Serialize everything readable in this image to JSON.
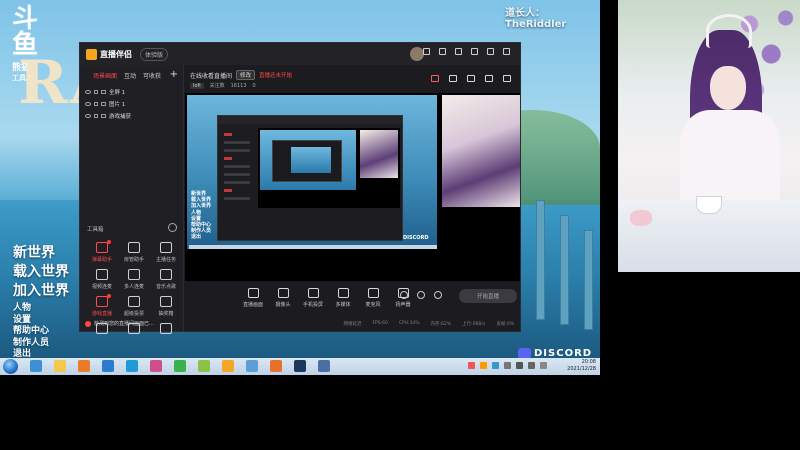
{
  "streamer": {
    "label": "道长人：TheRiddler"
  },
  "douyu": {
    "logo_big": "斗鱼",
    "logo_small": "熊猫",
    "logo_tag": "工具箱"
  },
  "game": {
    "logo": "RAF",
    "menu_big": [
      "新世界",
      "载入世界",
      "加入世界"
    ],
    "menu_small": [
      "人物",
      "设置",
      "帮助中心",
      "制作人员",
      "退出"
    ]
  },
  "discord": {
    "label": "DISCORD"
  },
  "app": {
    "name": "直播伴侣",
    "version_badge": "体验版",
    "side_tabs": [
      "场景画面",
      "互动",
      "可收获"
    ],
    "add_symbol": "+",
    "scenes": [
      "全屏 1",
      "图片 1",
      "游戏捕获"
    ],
    "toolbox": {
      "title": "工具箱",
      "tools": [
        {
          "label": "弹幕助手",
          "icon": "danmaku-icon",
          "active": true
        },
        {
          "label": "房管助手",
          "icon": "admin-icon",
          "active": false
        },
        {
          "label": "主播任务",
          "icon": "task-icon",
          "active": false
        },
        {
          "label": "视频连麦",
          "icon": "video-link-icon",
          "active": false
        },
        {
          "label": "多人连麦",
          "icon": "multi-link-icon",
          "active": false
        },
        {
          "label": "音乐点歌",
          "icon": "music-icon",
          "active": false
        },
        {
          "label": "游戏直播",
          "icon": "game-live-icon",
          "active": true
        },
        {
          "label": "超级投票",
          "icon": "vote-icon",
          "active": false
        },
        {
          "label": "抽奖箱",
          "icon": "lottery-icon",
          "active": false
        },
        {
          "label": "",
          "icon": "book-icon",
          "active": false
        },
        {
          "label": "",
          "icon": "image-tool-icon",
          "active": false
        },
        {
          "label": "",
          "icon": "download-icon",
          "active": false
        }
      ]
    },
    "notice": "检测到您的直播间画面已...",
    "scene_title": "在线收看直播间",
    "edit_label": "修改",
    "live_status": "直播还未开始",
    "meta": {
      "category": "lofi",
      "fans_label": "关注数",
      "fans_value": "16113",
      "heat": "0"
    },
    "controls": [
      {
        "label": "直播画面",
        "icon": "screen-capture-icon"
      },
      {
        "label": "摄像头",
        "icon": "camera-icon"
      },
      {
        "label": "手机投屏",
        "icon": "phone-cast-icon"
      },
      {
        "label": "多媒体",
        "icon": "media-icon"
      },
      {
        "label": "麦克风",
        "icon": "microphone-icon"
      },
      {
        "label": "扬声器",
        "icon": "speaker-icon"
      }
    ],
    "go_live": "开始直播",
    "status": [
      "网络延迟",
      "FPS:60",
      "CPU:34%",
      "内存:62%",
      "上行:0KB/s",
      "丢帧:0%"
    ]
  },
  "preview": {
    "nested_menu": [
      "新世界",
      "载入世界",
      "加入世界",
      "人物",
      "设置",
      "帮助中心",
      "制作人员",
      "退出"
    ],
    "discord": "DISCORD"
  },
  "clock": {
    "time": "20:08",
    "date": "2021/12/28"
  },
  "colors": {
    "accent_red": "#ff4747",
    "app_bg": "#1c1c20",
    "taskbar": "#c7d6e6"
  }
}
